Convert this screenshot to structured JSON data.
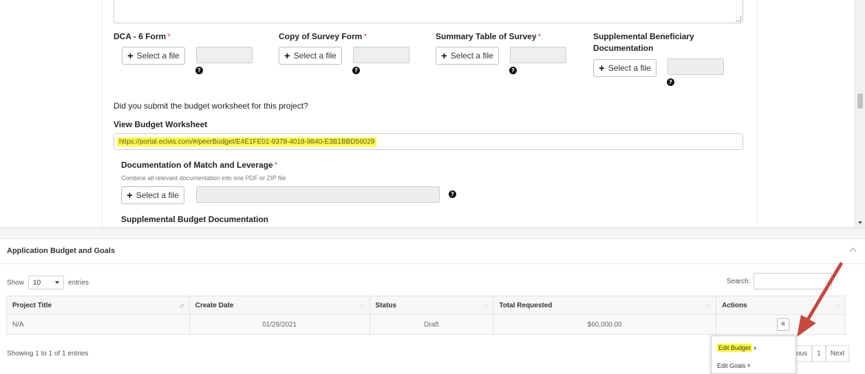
{
  "form": {
    "uploads": [
      {
        "label": "DCA - 6 Form",
        "required_mark": "*",
        "button": "Select a file"
      },
      {
        "label": "Copy of Survey Form",
        "required_mark": "*",
        "button": "Select a file"
      },
      {
        "label": "Summary Table of Survey",
        "required_mark": "*",
        "button": "Select a file"
      },
      {
        "label": "Supplemental Beneficiary",
        "label_line2": "Documentation",
        "required_mark": "",
        "button": "Select a file"
      }
    ],
    "budget_question": "Did you submit the budget worksheet for this project?",
    "view_budget_label": "View Budget Worksheet",
    "budget_url": "https://portal.ecivis.com/#/peerBudget/E4E1FE01-9378-4018-9840-E3B1BBD56029",
    "match_label": "Documentation of Match and Leverage",
    "match_required_mark": "*",
    "match_help": "Combine all relevant documentation into one PDF or ZIP file",
    "match_button": "Select a file",
    "supplemental_budget_label": "Supplemental Budget Documentation"
  },
  "panel": {
    "title": "Application Budget and Goals",
    "show_label": "Show",
    "entries_value": "10",
    "entries_label": "entries",
    "search_label": "Search:",
    "columns": [
      "Project Title",
      "Create Date",
      "Status",
      "Total Requested",
      "Actions"
    ],
    "rows": [
      {
        "project_title": "N/A",
        "create_date": "01/29/2021",
        "status": "Draft",
        "total_requested": "$60,000.00"
      }
    ],
    "showing_text": "Showing 1 to 1 of 1 entries",
    "pagination": {
      "previous": "ous",
      "page": "1",
      "next": "Next"
    },
    "actions_menu": {
      "edit_budget": "Edit Budget",
      "edit_goals": "Edit Goals"
    }
  },
  "icons": {
    "help": "question-circle-icon",
    "plus": "plus-icon",
    "menu": "hamburger-icon",
    "chevron": "chevron-right-icon",
    "annotation": "red-arrow"
  },
  "colors": {
    "required": "#d9534f",
    "highlight": "#fbfb3a",
    "annotation_arrow": "#c8473f"
  }
}
